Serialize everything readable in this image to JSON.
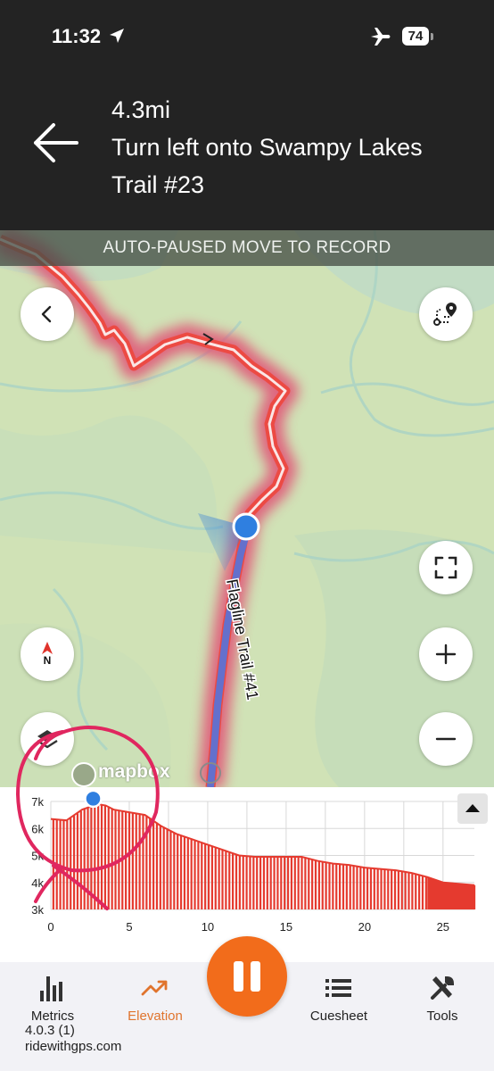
{
  "status": {
    "time": "11:32",
    "battery": "74"
  },
  "navigation": {
    "distance": "4.3mi",
    "instruction_line1": "Turn left onto Swampy Lakes",
    "instruction_line2": "Trail #23"
  },
  "banner": {
    "text": "AUTO-PAUSED MOVE TO RECORD"
  },
  "map": {
    "trail_label": "Flagline Trail #41",
    "attribution": "mapbox",
    "compass_label": "N"
  },
  "icons": {
    "back": "chevron-left-icon",
    "route": "route-pin-icon",
    "fullscreen": "expand-icon",
    "zoom_in": "plus-icon",
    "zoom_out": "minus-icon",
    "compass": "compass-icon",
    "layers": "layers-icon"
  },
  "colors": {
    "header_bg": "#232323",
    "route": "#e8463c",
    "route_inner": "#5a68c8",
    "accent": "#f26c1b",
    "map_bg": "#cfe1b7",
    "elevation_fill": "#e53a2f"
  },
  "chart_data": {
    "type": "area",
    "y_ticks": [
      "7k",
      "6k",
      "5k",
      "4k",
      "3k"
    ],
    "x_ticks": [
      "0",
      "5",
      "10",
      "15",
      "20",
      "25"
    ],
    "xlim": [
      0,
      27
    ],
    "ylim": [
      3000,
      7000
    ],
    "current_position_mi": 2.7,
    "x": [
      0,
      1,
      2,
      3,
      3.5,
      4,
      5,
      6,
      7,
      8,
      9,
      10,
      11,
      12,
      13,
      14,
      15,
      16,
      17,
      18,
      19,
      20,
      21,
      22,
      23,
      24,
      25,
      26,
      27
    ],
    "y": [
      6350,
      6300,
      6700,
      6900,
      6850,
      6700,
      6600,
      6500,
      6100,
      5800,
      5600,
      5400,
      5200,
      5000,
      4950,
      4950,
      4950,
      4950,
      4800,
      4700,
      4650,
      4550,
      4500,
      4450,
      4350,
      4200,
      4000,
      3950,
      3900
    ]
  },
  "tabs": [
    {
      "label": "Metrics",
      "icon": "bar-chart-icon"
    },
    {
      "label": "Elevation",
      "icon": "trending-up-icon"
    },
    {
      "label": "Cuesheet",
      "icon": "list-icon"
    },
    {
      "label": "Tools",
      "icon": "tools-icon"
    }
  ],
  "version": {
    "line1": "4.0.3 (1)",
    "line2": "ridewithgps.com"
  }
}
